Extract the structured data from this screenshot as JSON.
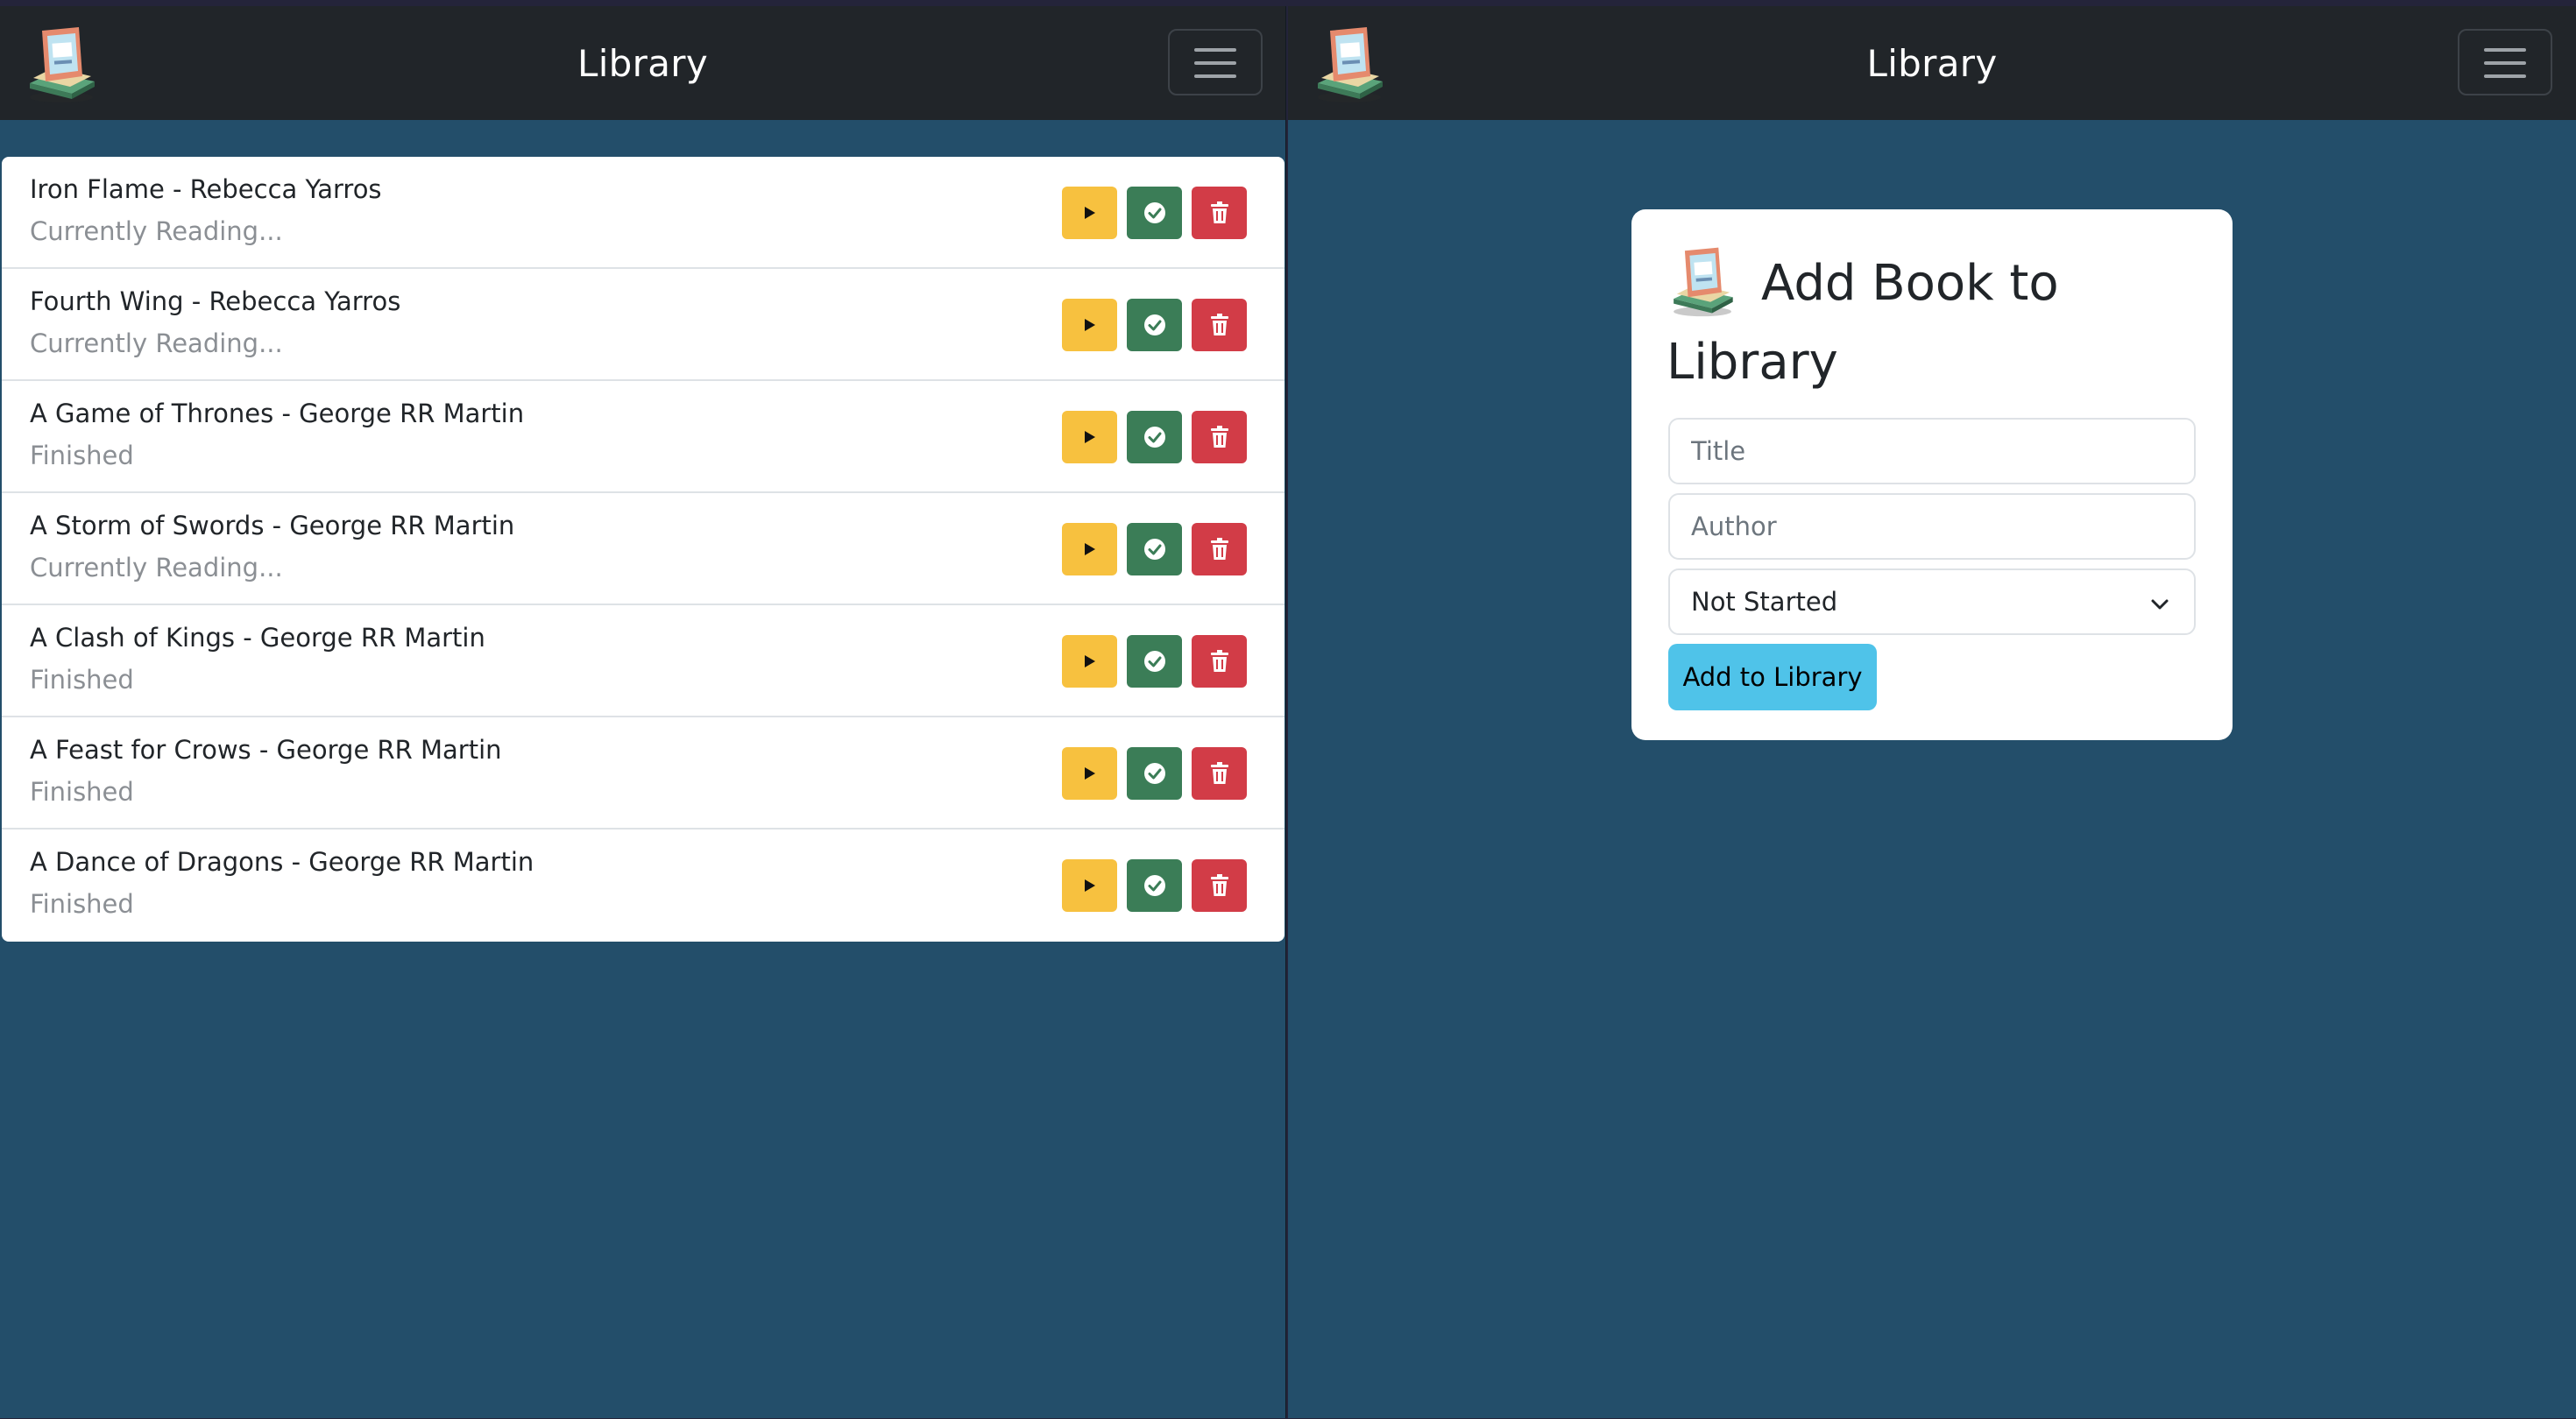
{
  "app": {
    "title": "Library",
    "logo_icon": "book-stand-icon",
    "menu_icon": "hamburger-menu-icon"
  },
  "library_view": {
    "books": [
      {
        "title": "Iron Flame - Rebecca Yarros",
        "status": "Currently Reading..."
      },
      {
        "title": "Fourth Wing - Rebecca Yarros",
        "status": "Currently Reading..."
      },
      {
        "title": "A Game of Thrones - George RR Martin",
        "status": "Finished"
      },
      {
        "title": "A Storm of Swords - George RR Martin",
        "status": "Currently Reading..."
      },
      {
        "title": "A Clash of Kings - George RR Martin",
        "status": "Finished"
      },
      {
        "title": "A Feast for Crows - George RR Martin",
        "status": "Finished"
      },
      {
        "title": "A Dance of Dragons - George RR Martin",
        "status": "Finished"
      }
    ],
    "actions": {
      "start_icon": "play-icon",
      "finish_icon": "check-circle-icon",
      "delete_icon": "trash-icon"
    }
  },
  "add_form": {
    "heading_line1": "Add Book to",
    "heading_line2": "Library",
    "title_placeholder": "Title",
    "author_placeholder": "Author",
    "status_selected": "Not Started",
    "submit_label": "Add to Library"
  },
  "colors": {
    "navbar": "#212529",
    "background": "#234e6a",
    "start_button": "#f7c13f",
    "finish_button": "#3b7d57",
    "delete_button": "#d23c47",
    "submit_button": "#4fc3e9"
  }
}
